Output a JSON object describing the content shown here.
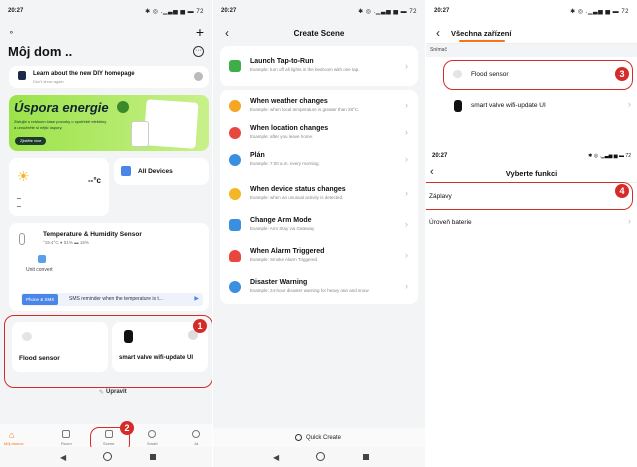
{
  "home": {
    "status": {
      "time": "20:27",
      "signal": "✱ ◎ .▁▃▅ ▅ ▬ 72"
    },
    "title": "Môj dom ..",
    "diy": {
      "title": "Learn about the new DIY homepage",
      "sub": "Don't show again"
    },
    "banner": {
      "title": "Úspora energie",
      "line1": "Zistujte s reálnom čase pozorky o spotřebě elektriny",
      "line2": "a umožněte si nější úspory.",
      "button": "Zjistěte více"
    },
    "weather": {
      "temp": "--°c"
    },
    "all_devices": "All Devices",
    "sensor": {
      "title": "Temperature & Humidity Sensor",
      "values": "°19.4°C  ● 51%  ▬ 16%"
    },
    "unit_convert": "Unit convert",
    "sms": {
      "tag": "Phone & SMS",
      "text": "SMS reminder when the temperature is t..."
    },
    "dev1": "Flood sensor",
    "dev2": "smart valve wifi-update UI",
    "edit": "Upravit",
    "tabs": [
      "Môj domov",
      "Room",
      "Scene",
      "Smart",
      "Ja"
    ]
  },
  "scene": {
    "status": {
      "time": "20:27"
    },
    "title": "Create Scene",
    "items": [
      {
        "title": "Launch Tap-to-Run",
        "sub": "Example: turn off all lights in the bedroom with one tap.",
        "color": "#3fae49"
      },
      {
        "title": "When weather changes",
        "sub": "Example: when local temperature is greater than 28°C.",
        "color": "#f5a623"
      },
      {
        "title": "When location changes",
        "sub": "Example: after you leave home.",
        "color": "#e8473f"
      },
      {
        "title": "Plán",
        "sub": "Example: 7:00 a.m. every morning.",
        "color": "#3b8fe0"
      },
      {
        "title": "When device status changes",
        "sub": "Example: when an unusual activity is detected.",
        "color": "#f3b626"
      },
      {
        "title": "Change Arm Mode",
        "sub": "Example: Arm Stay via Gateway",
        "color": "#3b8fe0"
      },
      {
        "title": "When Alarm Triggered",
        "sub": "Example: Smoke Alarm Triggered",
        "color": "#e8473f"
      },
      {
        "title": "Disaster Warning",
        "sub": "Example: 24-hour disaster warning for heavy rain and snow",
        "color": "#3b8fe0"
      }
    ],
    "quick_create": "Quick Create"
  },
  "devices": {
    "status": {
      "time": "20:27"
    },
    "tab": "Všechna zařízení",
    "section": "Snímač",
    "items": [
      "Flood sensor",
      "smart valve wifi-update UI"
    ],
    "functions_title": "Vyberte funkci",
    "functions": [
      "Záplavy",
      "Úroveň baterie"
    ]
  },
  "badges": [
    "1",
    "2",
    "3",
    "4"
  ]
}
